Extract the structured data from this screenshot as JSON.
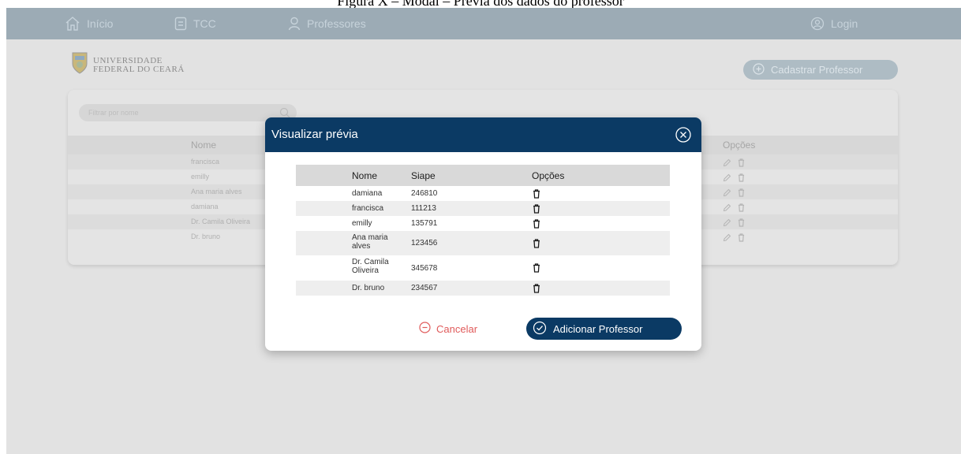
{
  "caption": "Figura X – Modal – Prévia dos dados do professor",
  "navbar": {
    "items": [
      {
        "label": "Início",
        "icon": "home-icon"
      },
      {
        "label": "TCC",
        "icon": "document-icon"
      },
      {
        "label": "Professores",
        "icon": "user-icon"
      }
    ],
    "login_label": "Login"
  },
  "logo": {
    "line1": "UNIVERSIDADE",
    "line2": "FEDERAL DO CEARÁ"
  },
  "cadastrar_label": "Cadastrar Professor",
  "background_table": {
    "search_placeholder": "Filtrar por nome",
    "columns": {
      "nome": "Nome",
      "opcoes": "Opções"
    },
    "rows": [
      "francisca",
      "emilly",
      "Ana maria alves",
      "damiana",
      "Dr. Camila Oliveira",
      "Dr. bruno"
    ]
  },
  "modal": {
    "title": "Visualizar prévia",
    "columns": {
      "nome": "Nome",
      "siape": "Siape",
      "opcoes": "Opções"
    },
    "rows": [
      {
        "nome": "damiana",
        "siape": "246810"
      },
      {
        "nome": "francisca",
        "siape": "111213"
      },
      {
        "nome": "emilly",
        "siape": "135791"
      },
      {
        "nome": "Ana maria alves",
        "siape": "123456"
      },
      {
        "nome": "Dr. Camila Oliveira",
        "siape": "345678"
      },
      {
        "nome": "Dr. bruno",
        "siape": "234567"
      }
    ],
    "cancel_label": "Cancelar",
    "add_label": "Adicionar Professor"
  },
  "colors": {
    "navbar": "#9cabb5",
    "modal_header": "#0b3a64",
    "cancel": "#e05a5a",
    "primary_button": "#0b3a64"
  }
}
